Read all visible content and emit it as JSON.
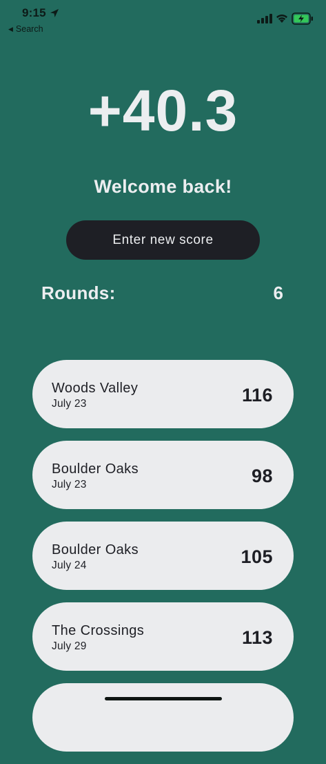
{
  "status_bar": {
    "time": "9:15",
    "back_label": "Search",
    "icons": [
      "location-arrow-icon",
      "cell-signal-icon",
      "wifi-icon",
      "battery-charging-icon"
    ]
  },
  "main": {
    "handicap": "+40.3",
    "welcome": "Welcome back!",
    "enter_button": "Enter new score",
    "rounds_label": "Rounds:",
    "rounds_count": "6"
  },
  "rounds": [
    {
      "course": "Woods Valley",
      "date": "July 23",
      "score": "116"
    },
    {
      "course": "Boulder Oaks",
      "date": "July 23",
      "score": "98"
    },
    {
      "course": "Boulder Oaks",
      "date": "July 24",
      "score": "105"
    },
    {
      "course": "The Crossings",
      "date": "July 29",
      "score": "113"
    },
    {
      "course": "",
      "date": "",
      "score": ""
    }
  ],
  "colors": {
    "background": "#226B5E",
    "button": "#1E1F25",
    "card": "#EBECEE",
    "text_light": "#ECEEF0",
    "text_dark": "#1E1F25",
    "battery_fill": "#34C759"
  }
}
